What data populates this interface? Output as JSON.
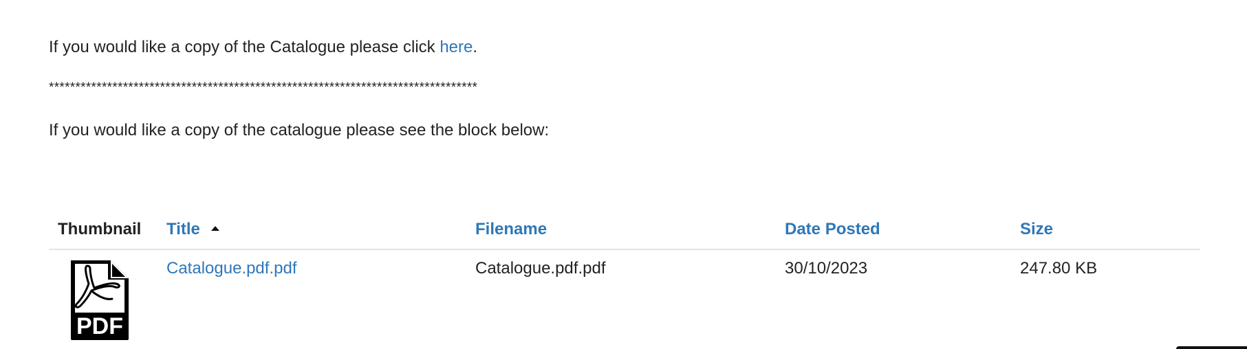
{
  "intro": {
    "line1_text": "If you would like a copy of the Catalogue please click ",
    "line1_link": "here",
    "line1_end": ".",
    "separator": "*********************************************************************************",
    "line3_text": "If you would like a copy of the catalogue please see the block below:"
  },
  "table": {
    "headers": {
      "thumbnail": "Thumbnail",
      "title": "Title",
      "filename": "Filename",
      "date_posted": "Date Posted",
      "size": "Size"
    },
    "sort": {
      "column": "title",
      "direction": "ascending"
    },
    "rows": [
      {
        "thumbnail_icon": "pdf-file-icon",
        "thumbnail_label": "PDF",
        "title": "Catalogue.pdf.pdf",
        "filename": "Catalogue.pdf.pdf",
        "date_posted": "30/10/2023",
        "size": "247.80 KB"
      }
    ]
  },
  "colors": {
    "link": "#2f77b8",
    "text": "#222222",
    "divider": "#e3e3e3"
  }
}
